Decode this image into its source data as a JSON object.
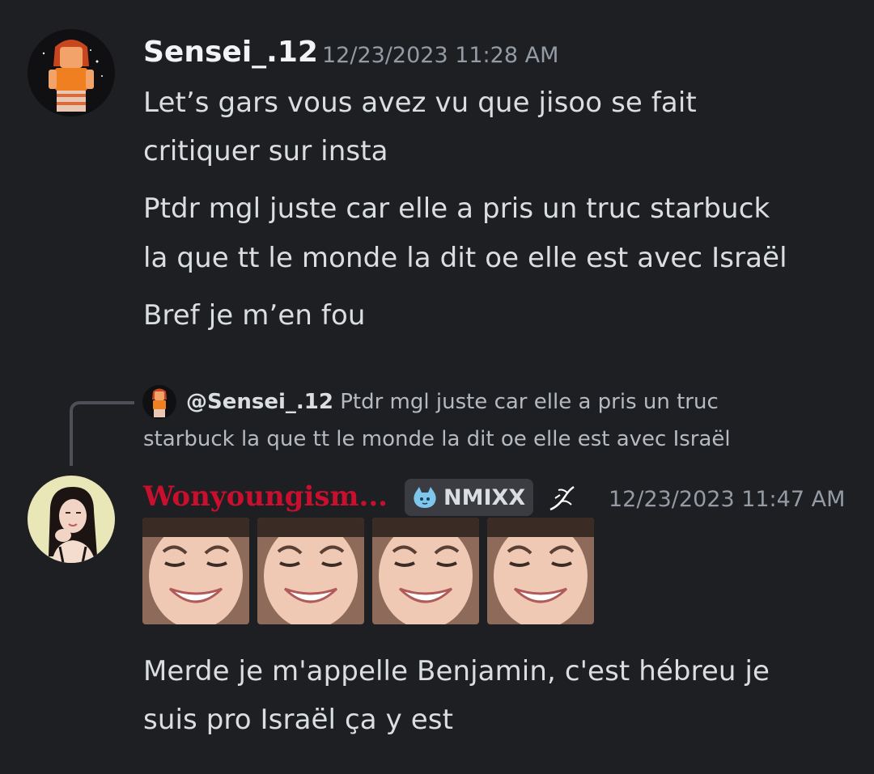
{
  "colors": {
    "background": "#1e1f22",
    "text": "#dbdee1",
    "muted": "#949ba4",
    "username_sensei": "#f2f3f5",
    "username_won": "#c8102e"
  },
  "message1": {
    "username": "Sensei_.12",
    "timestamp": "12/23/2023 11:28 AM",
    "avatar_icon": "roblox-avatar-icon",
    "lines": [
      "Let’s gars vous avez vu que jisoo se fait",
      "critiquer sur insta",
      "Ptdr mgl juste car elle a pris un truc starbuck",
      "la que tt le monde la dit oe elle est avec Israël",
      "Bref je m’en fou"
    ]
  },
  "reply": {
    "mention": "@Sensei_.12",
    "line1": "Ptdr mgl juste car elle a pris un truc",
    "line2": "starbuck la que tt le monde la dit oe elle est avec Israël"
  },
  "message2": {
    "username": "Wonyoungism...",
    "tag": "NMIXX",
    "tag_icon": "cat-paw-icon",
    "timestamp": "12/23/2023 11:47 AM",
    "avatar_icon": "profile-photo-icon",
    "emojis": [
      "crying-smile-emoji",
      "crying-smile-emoji",
      "crying-smile-emoji",
      "crying-smile-emoji"
    ],
    "lines": [
      "Merde je m'appelle Benjamin, c'est hébreu je",
      "suis pro Israël ça y est"
    ]
  }
}
